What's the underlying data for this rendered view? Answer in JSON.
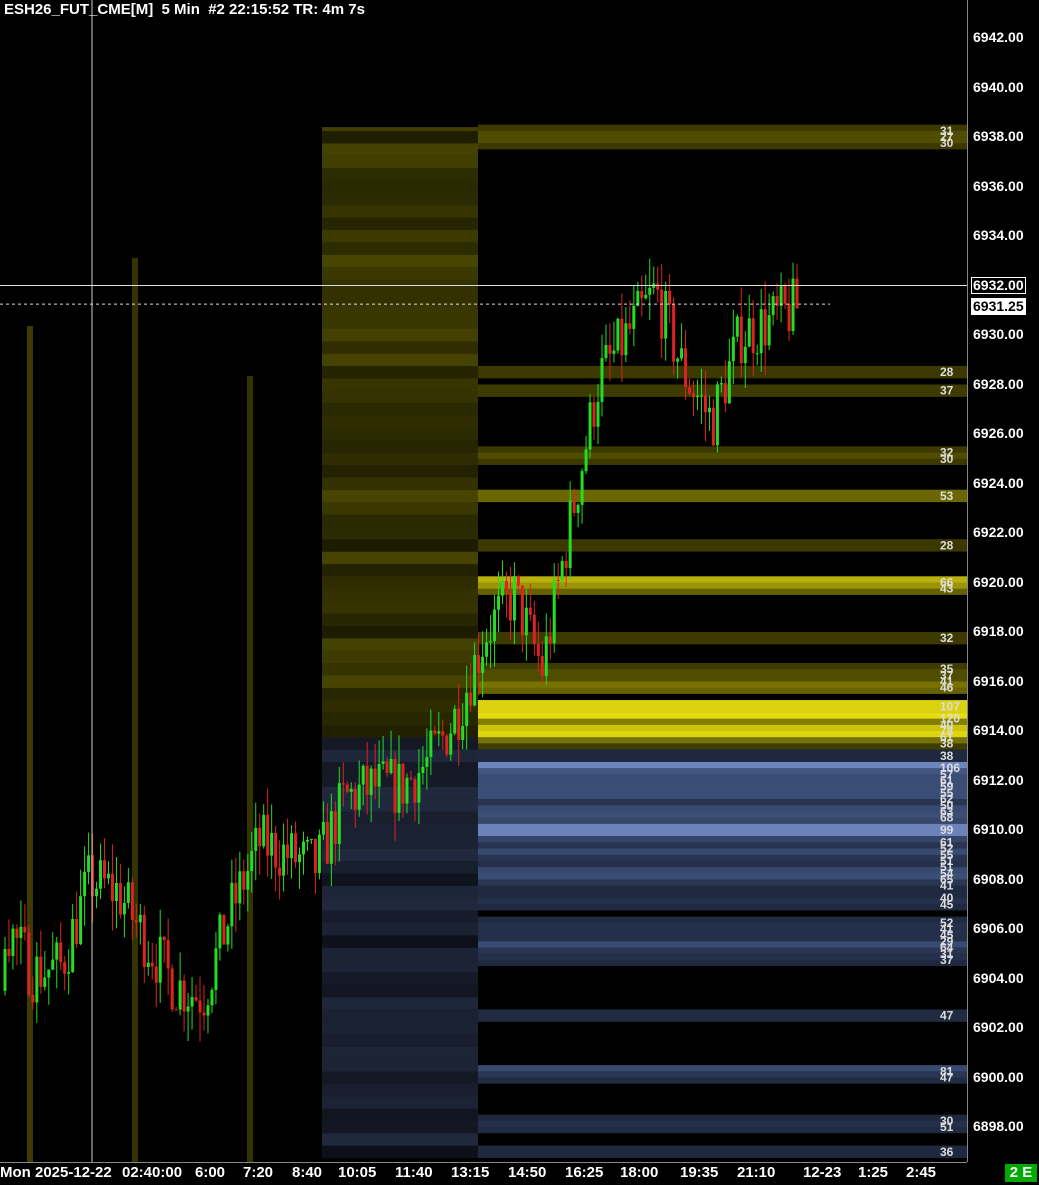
{
  "title": "ESH26_FUT_CME[M]  5 Min  #2 22:15:52 TR: 4m 7s",
  "badge": "2 E",
  "crosshair_price": "6932.00",
  "last_price": "6931.25",
  "colors": {
    "up": "#22dd22",
    "down": "#dd2222",
    "ask_depth": "#d8d010",
    "bid_depth": "#5b74a8",
    "axis_bg": "#000000"
  },
  "chart_data": {
    "type": "candlestick",
    "title": "ESH26_FUT_CME[M]  5 Min  #2 22:15:52 TR: 4m 7s",
    "ylim": [
      6896.9,
      6943.5
    ],
    "price_ticks": [
      "6942.00",
      "6940.00",
      "6938.00",
      "6936.00",
      "6934.00",
      "6932.00",
      "6930.00",
      "6928.00",
      "6926.00",
      "6924.00",
      "6922.00",
      "6920.00",
      "6918.00",
      "6916.00",
      "6914.00",
      "6912.00",
      "6910.00",
      "6908.00",
      "6906.00",
      "6904.00",
      "6902.00",
      "6900.00",
      "6898.00"
    ],
    "time_ticks": [
      "Mon 2025-12-22",
      "02:40:00",
      "6:00",
      "7:20",
      "8:40",
      "10:05",
      "11:40",
      "13:15",
      "14:50",
      "16:25",
      "18:00",
      "19:35",
      "21:10",
      "12-23",
      "1:25",
      "2:45"
    ],
    "depth_ask": [
      {
        "price": 6938.25,
        "size": 31
      },
      {
        "price": 6938.0,
        "size": 27
      },
      {
        "price": 6937.75,
        "size": 30
      },
      {
        "price": 6928.5,
        "size": 28
      },
      {
        "price": 6927.75,
        "size": 37
      },
      {
        "price": 6925.25,
        "size": 32
      },
      {
        "price": 6925.0,
        "size": 30
      },
      {
        "price": 6923.5,
        "size": 53
      },
      {
        "price": 6921.5,
        "size": 28
      },
      {
        "price": 6920.0,
        "size": 66
      },
      {
        "price": 6919.75,
        "size": 43
      },
      {
        "price": 6917.75,
        "size": 32
      },
      {
        "price": 6916.5,
        "size": 35
      },
      {
        "price": 6916.25,
        "size": 37
      },
      {
        "price": 6916.0,
        "size": 41
      },
      {
        "price": 6915.75,
        "size": 46
      },
      {
        "price": 6915.0,
        "size": 107
      },
      {
        "price": 6914.5,
        "size": 120
      },
      {
        "price": 6914.25,
        "size": 40
      },
      {
        "price": 6914.0,
        "size": 78
      },
      {
        "price": 6913.75,
        "size": 61
      },
      {
        "price": 6913.5,
        "size": 38
      }
    ],
    "depth_bid": [
      {
        "price": 6913.0,
        "size": 38
      },
      {
        "price": 6912.5,
        "size": 106
      },
      {
        "price": 6912.25,
        "size": 57
      },
      {
        "price": 6912.0,
        "size": 61
      },
      {
        "price": 6911.75,
        "size": 59
      },
      {
        "price": 6911.5,
        "size": 55
      },
      {
        "price": 6911.25,
        "size": 62
      },
      {
        "price": 6911.0,
        "size": 50
      },
      {
        "price": 6910.75,
        "size": 63
      },
      {
        "price": 6910.5,
        "size": 68
      },
      {
        "price": 6910.0,
        "size": 99
      },
      {
        "price": 6909.5,
        "size": 61
      },
      {
        "price": 6909.25,
        "size": 52
      },
      {
        "price": 6909.0,
        "size": 55
      },
      {
        "price": 6908.75,
        "size": 51
      },
      {
        "price": 6908.5,
        "size": 51
      },
      {
        "price": 6908.25,
        "size": 54
      },
      {
        "price": 6908.0,
        "size": 65
      },
      {
        "price": 6907.75,
        "size": 41
      },
      {
        "price": 6907.25,
        "size": 40
      },
      {
        "price": 6907.0,
        "size": 45
      },
      {
        "price": 6906.25,
        "size": 52
      },
      {
        "price": 6906.0,
        "size": 41
      },
      {
        "price": 6905.75,
        "size": 45
      },
      {
        "price": 6905.5,
        "size": 29
      },
      {
        "price": 6905.25,
        "size": 64
      },
      {
        "price": 6905.0,
        "size": 31
      },
      {
        "price": 6904.75,
        "size": 37
      },
      {
        "price": 6902.5,
        "size": 47
      },
      {
        "price": 6900.25,
        "size": 81
      },
      {
        "price": 6900.0,
        "size": 47
      },
      {
        "price": 6898.25,
        "size": 30
      },
      {
        "price": 6898.0,
        "size": 51
      },
      {
        "price": 6897.0,
        "size": 36
      }
    ],
    "ohlc_anchors": [
      [
        6903.5,
        6909.0
      ],
      [
        6902.0,
        6906.5
      ],
      [
        6901.0,
        6908.0
      ],
      [
        6908.5,
        6907.5
      ],
      [
        6906.5,
        6908.5
      ],
      [
        6906.0,
        6905.0
      ],
      [
        6904.5,
        6903.0
      ],
      [
        6902.5,
        6904.0
      ],
      [
        6905.5,
        6908.0
      ],
      [
        6909.0,
        6910.0
      ],
      [
        6910.5,
        6907.5
      ],
      [
        6906.0,
        6911.0
      ],
      [
        6911.5,
        6911.0
      ],
      [
        6911.5,
        6912.0
      ],
      [
        6912.5,
        6911.0
      ],
      [
        6912.0,
        6913.5
      ],
      [
        6914.0,
        6915.5
      ],
      [
        6916.0,
        6920.0
      ],
      [
        6921.0,
        6918.0
      ],
      [
        6913.0,
        6920.0
      ],
      [
        6920.0,
        6925.0
      ],
      [
        6930.0,
        6926.5
      ],
      [
        6929.0,
        6931.0
      ],
      [
        6934.5,
        6929.0
      ],
      [
        6928.0,
        6929.0
      ],
      [
        6927.0,
        6926.0
      ],
      [
        6929.0,
        6931.0
      ],
      [
        6931.0,
        6930.0
      ],
      [
        6931.0,
        6931.25
      ]
    ]
  }
}
